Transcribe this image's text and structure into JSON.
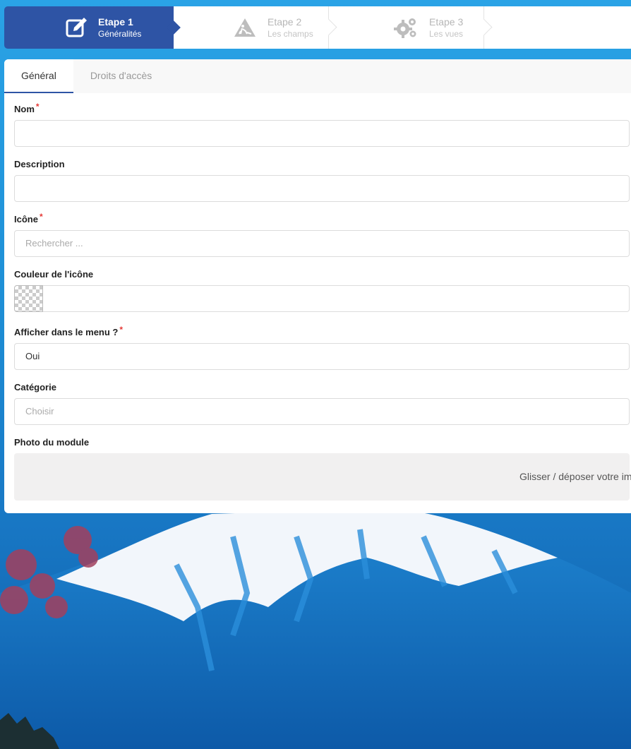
{
  "stepper": {
    "steps": [
      {
        "title": "Etape 1",
        "subtitle": "Généralités",
        "icon": "edit-icon",
        "active": true
      },
      {
        "title": "Etape 2",
        "subtitle": "Les champs",
        "icon": "roadwork-icon",
        "active": false
      },
      {
        "title": "Etape 3",
        "subtitle": "Les vues",
        "icon": "gears-icon",
        "active": false
      }
    ]
  },
  "tabs": [
    {
      "label": "Général",
      "active": true
    },
    {
      "label": "Droits d'accès",
      "active": false
    }
  ],
  "form": {
    "nom": {
      "label": "Nom",
      "value": ""
    },
    "description": {
      "label": "Description",
      "value": ""
    },
    "icone": {
      "label": "Icône",
      "placeholder": "Rechercher ..."
    },
    "couleur": {
      "label": "Couleur de l'icône",
      "value": ""
    },
    "menu": {
      "label": "Afficher dans le menu ?",
      "value": "Oui"
    },
    "categorie": {
      "label": "Catégorie",
      "placeholder": "Choisir"
    },
    "photo": {
      "label": "Photo du module",
      "dropzone_text": "Glisser / déposer votre im"
    }
  },
  "required_mark": "*",
  "colors": {
    "accent": "#2e54a5",
    "required": "#e53935",
    "sky": "#1e8fd6"
  }
}
